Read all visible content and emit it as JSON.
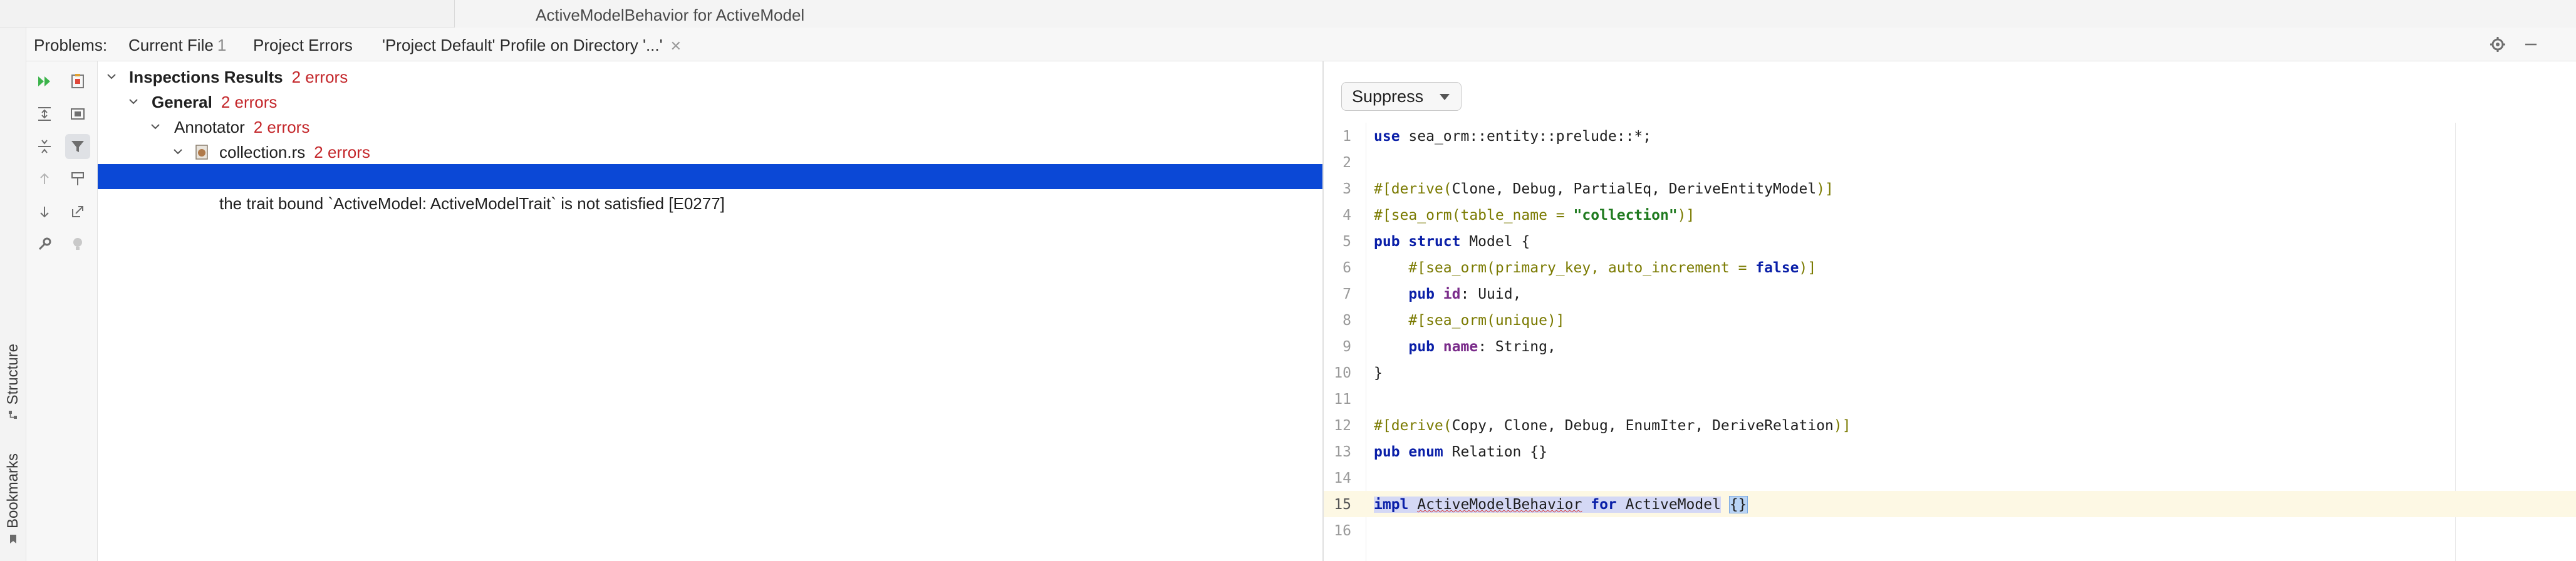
{
  "window": {
    "breadcrumb": "ActiveModelBehavior for ActiveModel"
  },
  "side_tabs": {
    "structure": "Structure",
    "bookmarks": "Bookmarks"
  },
  "problems": {
    "title": "Problems:",
    "tabs": [
      {
        "label": "Current File",
        "count": "1"
      },
      {
        "label": "Project Errors",
        "count": ""
      },
      {
        "label": "'Project Default' Profile on Directory '...'",
        "count": ""
      }
    ],
    "active_tab_index": 2
  },
  "tree": {
    "root": {
      "label": "Inspections Results",
      "errors": "2 errors"
    },
    "group": {
      "label": "General",
      "errors": "2 errors"
    },
    "sub": {
      "label": "Annotator",
      "errors": "2 errors"
    },
    "file": {
      "label": "collection.rs",
      "errors": "2 errors"
    },
    "selected_item": "",
    "message": "the trait bound `ActiveModel: ActiveModelTrait` is not satisfied [E0277]"
  },
  "preview": {
    "suppress_label": "Suppress",
    "current_line": 15,
    "line_numbers": [
      "1",
      "2",
      "3",
      "4",
      "5",
      "6",
      "7",
      "8",
      "9",
      "10",
      "11",
      "12",
      "13",
      "14",
      "15",
      "16"
    ]
  },
  "colors": {
    "accent": "#3574f0",
    "selection": "#0b48d6",
    "error": "#c4272b",
    "keyword": "#0a1fa8",
    "attribute": "#7a7a00",
    "string": "#1f7a1f"
  },
  "icons": [
    "run-icon",
    "profile-icon",
    "expand-all-icon",
    "collapse-all-icon",
    "group-icon",
    "filter-icon",
    "prev-icon",
    "next-icon",
    "autoscroll-icon",
    "export-icon",
    "wrench-icon",
    "bulb-icon",
    "gear-icon",
    "minimize-icon",
    "file-icon"
  ]
}
